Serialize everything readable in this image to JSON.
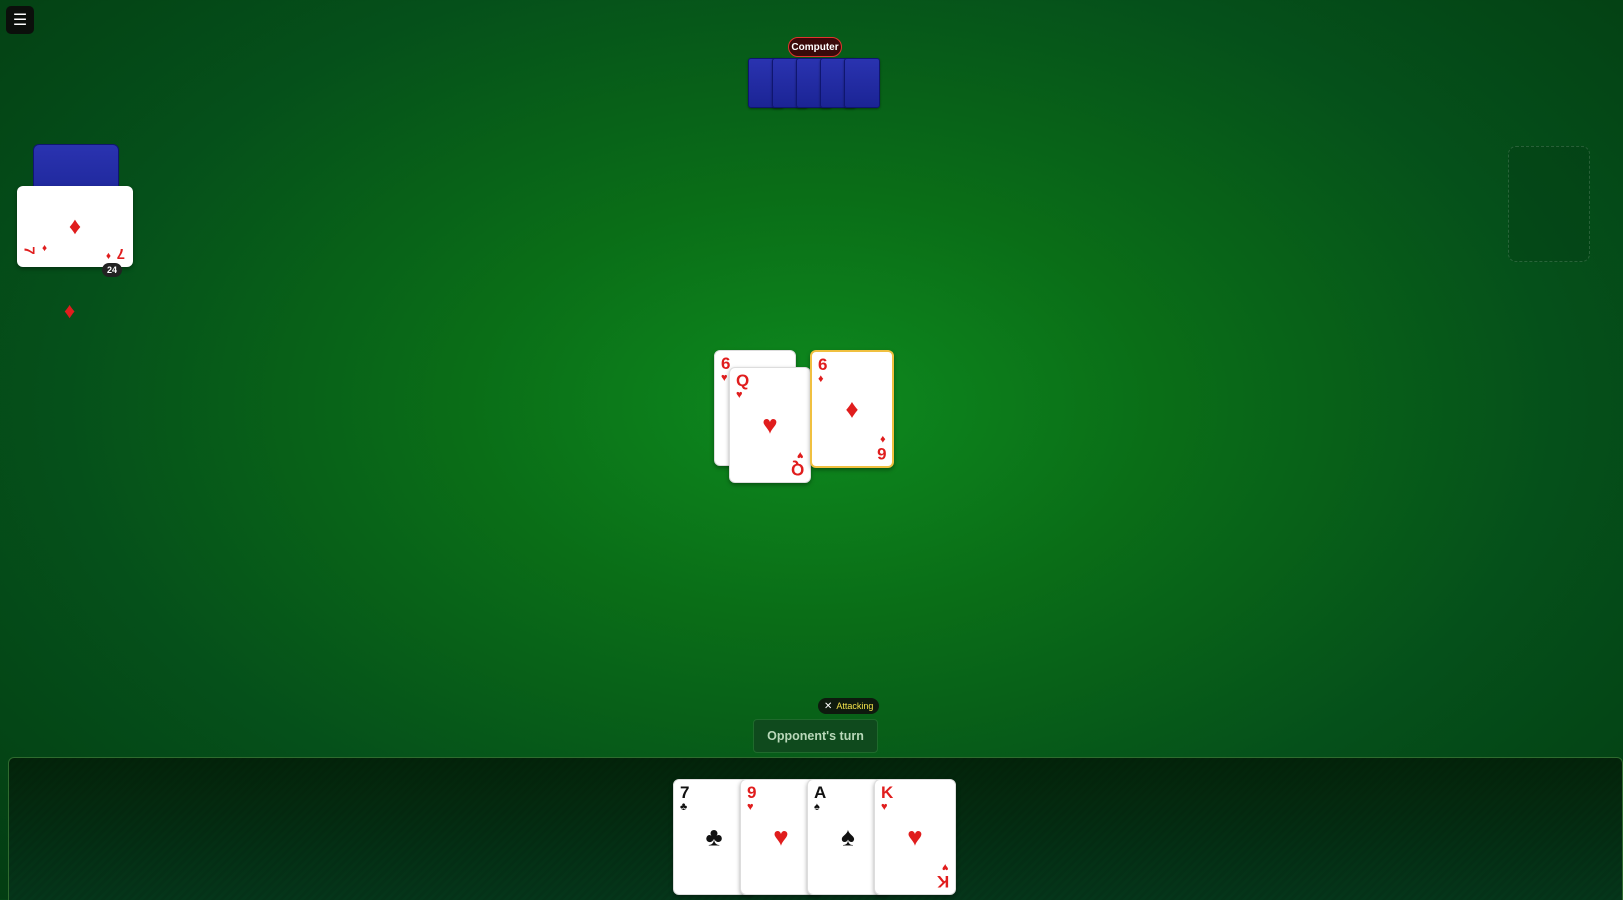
{
  "menu": {
    "icon": "menu-icon",
    "glyph": "☰"
  },
  "opponent": {
    "label": "Computer",
    "card_count": 5
  },
  "deck": {
    "trump_card": {
      "rank": "7",
      "suit": "♦",
      "color": "red"
    },
    "count": "24",
    "trump_suit": "♦"
  },
  "table": {
    "attack_1": {
      "rank": "6",
      "suit": "♥",
      "color": "red"
    },
    "defense_1": {
      "rank": "Q",
      "suit": "♥",
      "color": "red"
    },
    "attack_2": {
      "rank": "6",
      "suit": "♦",
      "color": "red"
    }
  },
  "status": {
    "badge_icon": "✕",
    "badge_label": "Attacking",
    "turn_label": "Opponent's turn"
  },
  "hand": [
    {
      "rank": "7",
      "suit": "♣",
      "color": "black"
    },
    {
      "rank": "9",
      "suit": "♥",
      "color": "red"
    },
    {
      "rank": "A",
      "suit": "♠",
      "color": "black"
    },
    {
      "rank": "K",
      "suit": "♥",
      "color": "red"
    }
  ],
  "colors": {
    "table": "#0a6e17",
    "card_back": "#1b2495",
    "red_suit": "#e01d1d",
    "highlight": "#f0c040"
  }
}
